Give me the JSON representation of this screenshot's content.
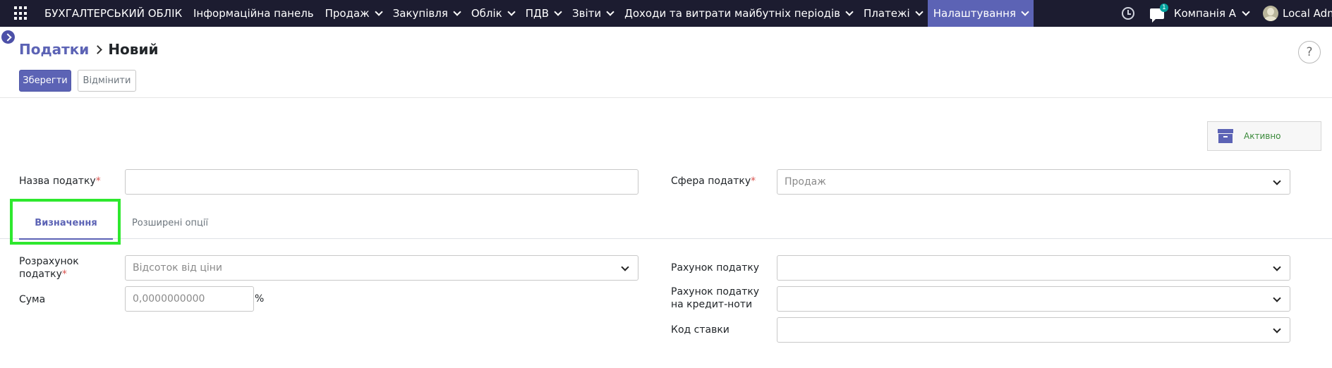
{
  "navbar": {
    "brand": "БУХГАЛТЕРСЬКИЙ ОБЛІК",
    "menu": [
      {
        "label": "Інформаційна панель",
        "has_dropdown": false,
        "active": false
      },
      {
        "label": "Продаж",
        "has_dropdown": true,
        "active": false
      },
      {
        "label": "Закупівля",
        "has_dropdown": true,
        "active": false
      },
      {
        "label": "Облік",
        "has_dropdown": true,
        "active": false
      },
      {
        "label": "ПДВ",
        "has_dropdown": true,
        "active": false
      },
      {
        "label": "Звіти",
        "has_dropdown": true,
        "active": false
      },
      {
        "label": "Доходи та витрати майбутніх періодів",
        "has_dropdown": true,
        "active": false
      },
      {
        "label": "Платежі",
        "has_dropdown": true,
        "active": false
      },
      {
        "label": "Налаштування",
        "has_dropdown": true,
        "active": true
      }
    ],
    "activity_icon": "clock-icon",
    "messages_icon": "chat-icon",
    "messages_badge": "1",
    "company": "Компанія А",
    "user": "Local Admi"
  },
  "breadcrumb": {
    "parent": "Податки",
    "current": "Новий"
  },
  "buttons": {
    "save": "Зберегти",
    "discard": "Відмінити",
    "help": "?"
  },
  "status": {
    "active_label": "Активно"
  },
  "form": {
    "tax_name": {
      "label": "Назва податку",
      "value": "",
      "required": true
    },
    "tax_scope": {
      "label": "Сфера податку",
      "value": "Продаж",
      "required": true
    },
    "tabs": [
      {
        "label": "Визначення",
        "active": true
      },
      {
        "label": "Розширені опції",
        "active": false
      }
    ],
    "tax_computation": {
      "label_line1": "Розрахунок",
      "label_line2": "податку",
      "value": "Відсоток від ціни",
      "required": true
    },
    "amount": {
      "label": "Сума",
      "value": "0,0000000000",
      "unit": "%"
    },
    "tax_account": {
      "label": "Рахунок податку",
      "value": ""
    },
    "credit_note_account": {
      "label_line1": "Рахунок податку",
      "label_line2": "на кредит-ноти",
      "value": ""
    },
    "rate_code": {
      "label": "Код ставки",
      "value": ""
    }
  },
  "colors": {
    "navbar_bg": "#1c1c30",
    "accent": "#5c63b5",
    "highlight_box": "#2ee82e"
  }
}
